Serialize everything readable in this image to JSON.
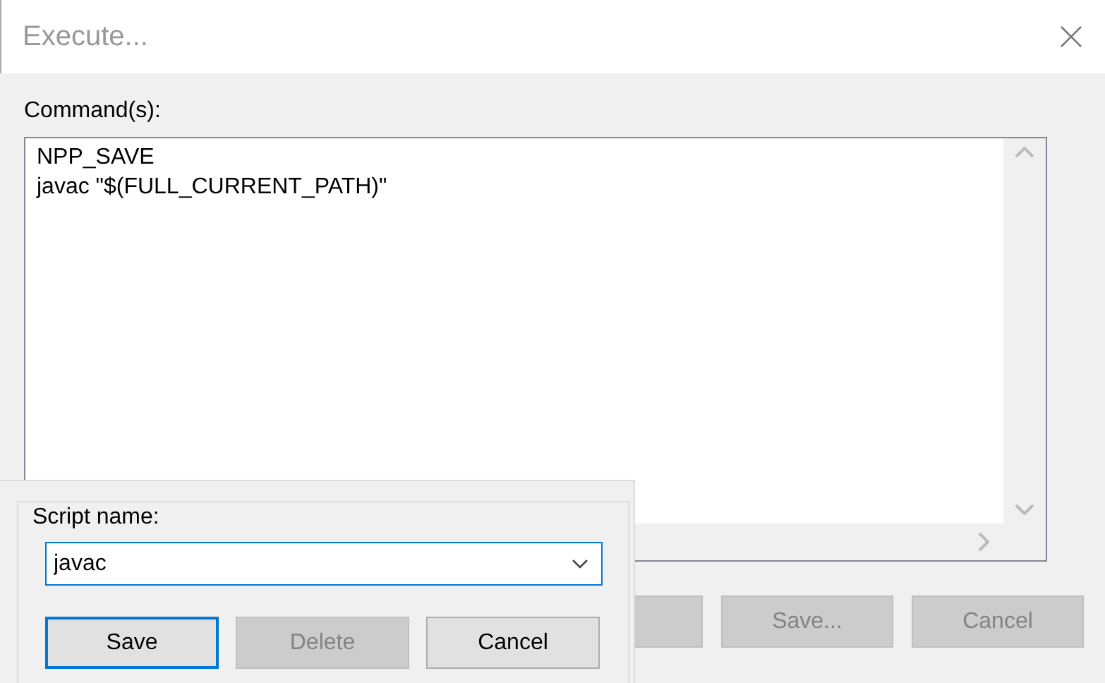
{
  "window": {
    "title": "Execute..."
  },
  "commands": {
    "label": "Command(s):",
    "lines": [
      "NPP_SAVE",
      "javac \"$(FULL_CURRENT_PATH)\""
    ]
  },
  "buttons": [
    {
      "label": "Save...",
      "disabled": true
    },
    {
      "label": "Cancel",
      "disabled": true
    }
  ],
  "script_panel": {
    "label": "Script name:",
    "value": "javac",
    "buttons": [
      {
        "label": "Save",
        "disabled": false,
        "focused": true
      },
      {
        "label": "Delete",
        "disabled": true,
        "focused": false
      },
      {
        "label": "Cancel",
        "disabled": false,
        "focused": false
      }
    ]
  }
}
